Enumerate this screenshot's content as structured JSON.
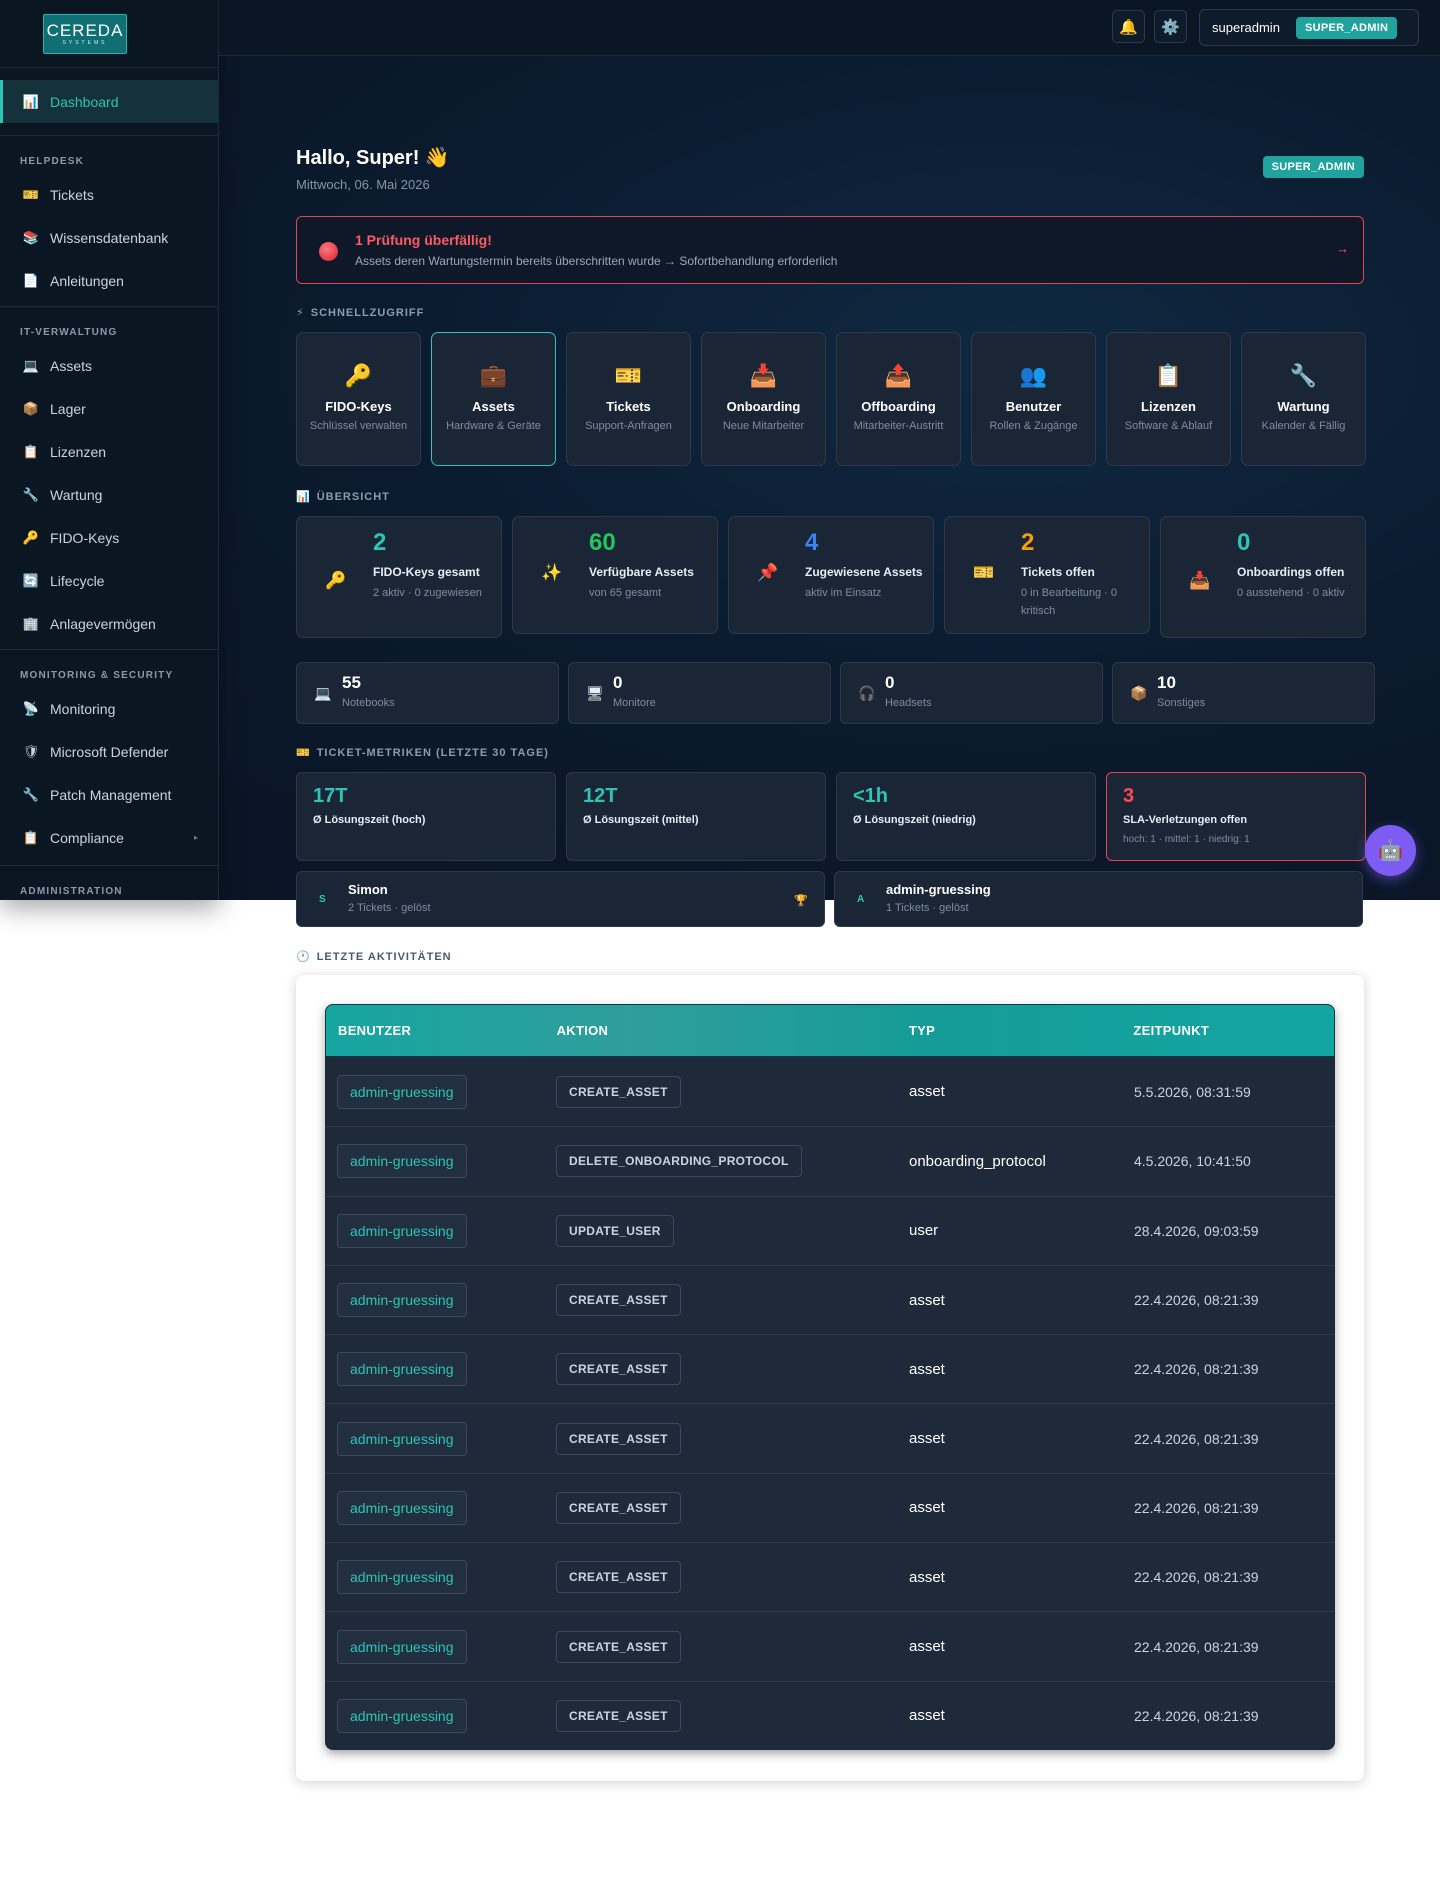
{
  "sidebar": {
    "logo_main": "CEREDA",
    "logo_sub": "SYSTEMS",
    "dashboard": "Dashboard",
    "sections": {
      "helpdesk": "HELPDESK",
      "it": "IT-VERWALTUNG",
      "monitoring": "MONITORING & SECURITY",
      "admin": "ADMINISTRATION"
    },
    "helpdesk_items": [
      "Tickets",
      "Wissensdatenbank",
      "Anleitungen"
    ],
    "it_items": [
      "Assets",
      "Lager",
      "Lizenzen",
      "Wartung",
      "FIDO-Keys",
      "Lifecycle",
      "Anlagevermögen"
    ],
    "monitoring_items": [
      "Monitoring",
      "Microsoft Defender",
      "Patch Management",
      "Compliance"
    ]
  },
  "header": {
    "username": "superadmin",
    "role": "SUPER_ADMIN"
  },
  "main": {
    "greeting": "Hallo, Super! 👋",
    "date": "Mittwoch, 06. Mai 2026",
    "role_badge": "SUPER_ADMIN",
    "alert": {
      "title": "1 Prüfung überfällig!",
      "text": "Assets deren Wartungstermin bereits überschritten wurde → Sofortbehandlung erforderlich",
      "arrow": "→"
    },
    "quick_title": "SCHNELLZUGRIFF",
    "quick": [
      {
        "title": "FIDO-Keys",
        "sub": "Schlüssel verwalten",
        "icon": "key-icon"
      },
      {
        "title": "Assets",
        "sub": "Hardware & Geräte",
        "icon": "briefcase-icon"
      },
      {
        "title": "Tickets",
        "sub": "Support-Anfragen",
        "icon": "ticket-icon"
      },
      {
        "title": "Onboarding",
        "sub": "Neue Mitarbeiter",
        "icon": "inbox-icon"
      },
      {
        "title": "Offboarding",
        "sub": "Mitarbeiter-Austritt",
        "icon": "outbox-icon"
      },
      {
        "title": "Benutzer",
        "sub": "Rollen & Zugänge",
        "icon": "users-icon"
      },
      {
        "title": "Lizenzen",
        "sub": "Software & Ablauf",
        "icon": "clipboard-icon"
      },
      {
        "title": "Wartung",
        "sub": "Kalender & Fällig",
        "icon": "wrench-icon"
      }
    ],
    "overview_title": "ÜBERSICHT",
    "overview": [
      {
        "num": "2",
        "label": "FIDO-Keys gesamt",
        "sub": "2 aktiv · 0 zugewiesen",
        "color": "#2ec4b6"
      },
      {
        "num": "60",
        "label": "Verfügbare Assets",
        "sub": "von 65 gesamt",
        "color": "#22c55e"
      },
      {
        "num": "4",
        "label": "Zugewiesene Assets",
        "sub": "aktiv im Einsatz",
        "color": "#3b82f6"
      },
      {
        "num": "2",
        "label": "Tickets offen",
        "sub": "0 in Bearbeitung · 0 kritisch",
        "color": "#f59e0b"
      },
      {
        "num": "0",
        "label": "Onboardings offen",
        "sub": "0 ausstehend · 0 aktiv",
        "color": "#2ec4b6"
      }
    ],
    "devices": [
      {
        "num": "55",
        "sub": "Notebooks"
      },
      {
        "num": "0",
        "sub": "Monitore"
      },
      {
        "num": "0",
        "sub": "Headsets"
      },
      {
        "num": "10",
        "sub": "Sonstiges"
      }
    ],
    "metrics_title": "TICKET-METRIKEN (LETZTE 30 TAGE)",
    "metrics": [
      {
        "num": "17T",
        "label": "Ø Lösungszeit (hoch)",
        "sub": ""
      },
      {
        "num": "12T",
        "label": "Ø Lösungszeit (mittel)",
        "sub": ""
      },
      {
        "num": "<1h",
        "label": "Ø Lösungszeit (niedrig)",
        "sub": ""
      },
      {
        "num": "3",
        "label": "SLA-Verletzungen offen",
        "sub": "hoch: 1 · mittel: 1 · niedrig: 1"
      }
    ],
    "top_users": [
      {
        "initial": "S",
        "name": "Simon",
        "sub": "2 Tickets · gelöst"
      },
      {
        "initial": "A",
        "name": "admin-gruessing",
        "sub": "1 Tickets · gelöst"
      }
    ],
    "activity_title": "LETZTE AKTIVITÄTEN",
    "table": {
      "headers": [
        "BENUTZER",
        "AKTION",
        "TYP",
        "ZEITPUNKT"
      ],
      "rows": [
        [
          "admin-gruessing",
          "CREATE_ASSET",
          "asset",
          "5.5.2026, 08:31:59"
        ],
        [
          "admin-gruessing",
          "DELETE_ONBOARDING_PROTOCOL",
          "onboarding_protocol",
          "4.5.2026, 10:41:50"
        ],
        [
          "admin-gruessing",
          "UPDATE_USER",
          "user",
          "28.4.2026, 09:03:59"
        ],
        [
          "admin-gruessing",
          "CREATE_ASSET",
          "asset",
          "22.4.2026, 08:21:39"
        ],
        [
          "admin-gruessing",
          "CREATE_ASSET",
          "asset",
          "22.4.2026, 08:21:39"
        ],
        [
          "admin-gruessing",
          "CREATE_ASSET",
          "asset",
          "22.4.2026, 08:21:39"
        ],
        [
          "admin-gruessing",
          "CREATE_ASSET",
          "asset",
          "22.4.2026, 08:21:39"
        ],
        [
          "admin-gruessing",
          "CREATE_ASSET",
          "asset",
          "22.4.2026, 08:21:39"
        ],
        [
          "admin-gruessing",
          "CREATE_ASSET",
          "asset",
          "22.4.2026, 08:21:39"
        ],
        [
          "admin-gruessing",
          "CREATE_ASSET",
          "asset",
          "22.4.2026, 08:21:39"
        ]
      ]
    }
  },
  "colors": {
    "accent": "#2ec4b6",
    "danger": "#ff4a55",
    "bot": "#7c5cf2"
  }
}
